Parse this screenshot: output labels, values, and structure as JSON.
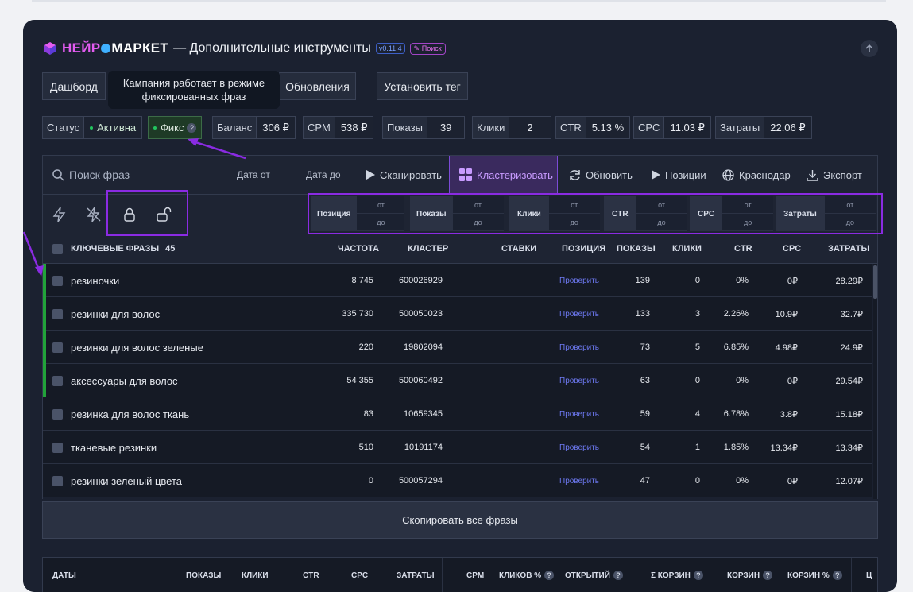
{
  "header": {
    "logo_part1": "НЕЙР",
    "logo_part2": "МАРКЕТ",
    "title": "— Дополнительные инструменты",
    "version": "v0.11.4",
    "badge": "Поиск"
  },
  "nav": {
    "dashboard": "Дашборд",
    "updates": "Обновления",
    "set_tag": "Установить тег"
  },
  "tooltip": {
    "line1": "Кампания работает в режиме",
    "line2": "фиксированных фраз"
  },
  "stats": {
    "status_label": "Статус",
    "status_value": "Активна",
    "fix_label": "Фикс",
    "balance_label": "Баланс",
    "balance_value": "306 ₽",
    "cpm_label": "CPM",
    "cpm_value": "538 ₽",
    "shows_label": "Показы",
    "shows_value": "39",
    "clicks_label": "Клики",
    "clicks_value": "2",
    "ctr_label": "CTR",
    "ctr_value": "5.13 %",
    "cpc_label": "CPC",
    "cpc_value": "11.03 ₽",
    "spend_label": "Затраты",
    "spend_value": "22.06 ₽"
  },
  "toolbar": {
    "search_placeholder": "Поиск фраз",
    "date_from": "Дата от",
    "dash": "—",
    "date_to": "Дата до",
    "scan": "Сканировать",
    "cluster": "Кластеризовать",
    "refresh": "Обновить",
    "positions": "Позиции",
    "region": "Краснодар",
    "export": "Экспорт"
  },
  "filters": {
    "from": "от",
    "to": "до",
    "position": "Позиция",
    "shows": "Показы",
    "clicks": "Клики",
    "ctr": "CTR",
    "cpc": "CPC",
    "spend": "Затраты"
  },
  "table": {
    "headers": {
      "phrases": "КЛЮЧЕВЫЕ ФРАЗЫ",
      "count": "45",
      "freq": "ЧАСТОТА",
      "cluster": "КЛАСТЕР",
      "bids": "СТАВКИ",
      "position": "ПОЗИЦИЯ",
      "shows": "ПОКАЗЫ",
      "clicks": "КЛИКИ",
      "ctr": "CTR",
      "cpc": "CPC",
      "spend": "ЗАТРАТЫ"
    },
    "check_label": "Проверить",
    "rows": [
      {
        "phrase": "резиночки",
        "freq": "8 745",
        "cluster": "600026929",
        "shows": "139",
        "clicks": "0",
        "ctr": "0%",
        "cpc": "0₽",
        "spend": "28.29₽",
        "fixed": true
      },
      {
        "phrase": "резинки для волос",
        "freq": "335 730",
        "cluster": "500050023",
        "shows": "133",
        "clicks": "3",
        "ctr": "2.26%",
        "cpc": "10.9₽",
        "spend": "32.7₽",
        "fixed": true
      },
      {
        "phrase": "резинки для волос зеленые",
        "freq": "220",
        "cluster": "19802094",
        "shows": "73",
        "clicks": "5",
        "ctr": "6.85%",
        "cpc": "4.98₽",
        "spend": "24.9₽",
        "fixed": true
      },
      {
        "phrase": "аксессуары для волос",
        "freq": "54 355",
        "cluster": "500060492",
        "shows": "63",
        "clicks": "0",
        "ctr": "0%",
        "cpc": "0₽",
        "spend": "29.54₽",
        "fixed": true
      },
      {
        "phrase": "резинка для волос ткань",
        "freq": "83",
        "cluster": "10659345",
        "shows": "59",
        "clicks": "4",
        "ctr": "6.78%",
        "cpc": "3.8₽",
        "spend": "15.18₽",
        "fixed": false
      },
      {
        "phrase": "тканевые резинки",
        "freq": "510",
        "cluster": "10191174",
        "shows": "54",
        "clicks": "1",
        "ctr": "1.85%",
        "cpc": "13.34₽",
        "spend": "13.34₽",
        "fixed": false
      },
      {
        "phrase": "резинки зеленый цвета",
        "freq": "0",
        "cluster": "500057294",
        "shows": "47",
        "clicks": "0",
        "ctr": "0%",
        "cpc": "0₽",
        "spend": "12.07₽",
        "fixed": false
      }
    ]
  },
  "copy_all": "Скопировать все фразы",
  "bottom_table": {
    "dates": "ДАТЫ",
    "shows": "ПОКАЗЫ",
    "clicks": "КЛИКИ",
    "ctr": "CTR",
    "cpc": "CPC",
    "spend": "ЗАТРАТЫ",
    "cpm": "CPM",
    "clicks_pct": "КЛИКОВ %",
    "opened": "ОТКРЫТИЙ",
    "sum_carts": "Σ КОРЗИН",
    "carts": "КОРЗИН",
    "carts_pct": "КОРЗИН %",
    "cut": "Ц"
  },
  "colors": {
    "panel_bg": "#1b2130",
    "accent_purple": "#8a2be2",
    "active_green": "#22c55e",
    "check_link": "#6d79f2"
  }
}
